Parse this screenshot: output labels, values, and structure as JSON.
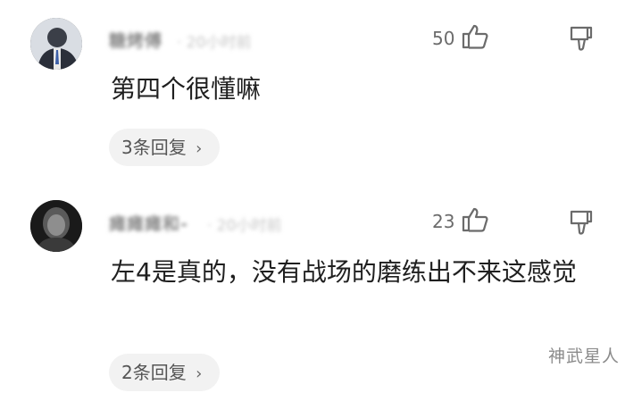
{
  "comments": [
    {
      "username": "糖烤傅",
      "time": "· 20小时前",
      "likes": "50",
      "text": "第四个很懂嘛",
      "replies": "3条回复",
      "avatar_color": "#2b2d33"
    },
    {
      "username": "瘫瘫瘫和-",
      "time": "· 20小时前",
      "likes": "23",
      "text": "左4是真的，没有战场的磨练出不来这感觉",
      "replies": "2条回复",
      "avatar_color": "#1b1b1b"
    }
  ],
  "watermark": "神武星人",
  "icons": {
    "like": "thumbs-up-icon",
    "dislike": "thumbs-down-icon",
    "chevron": "chevron-right-icon"
  }
}
